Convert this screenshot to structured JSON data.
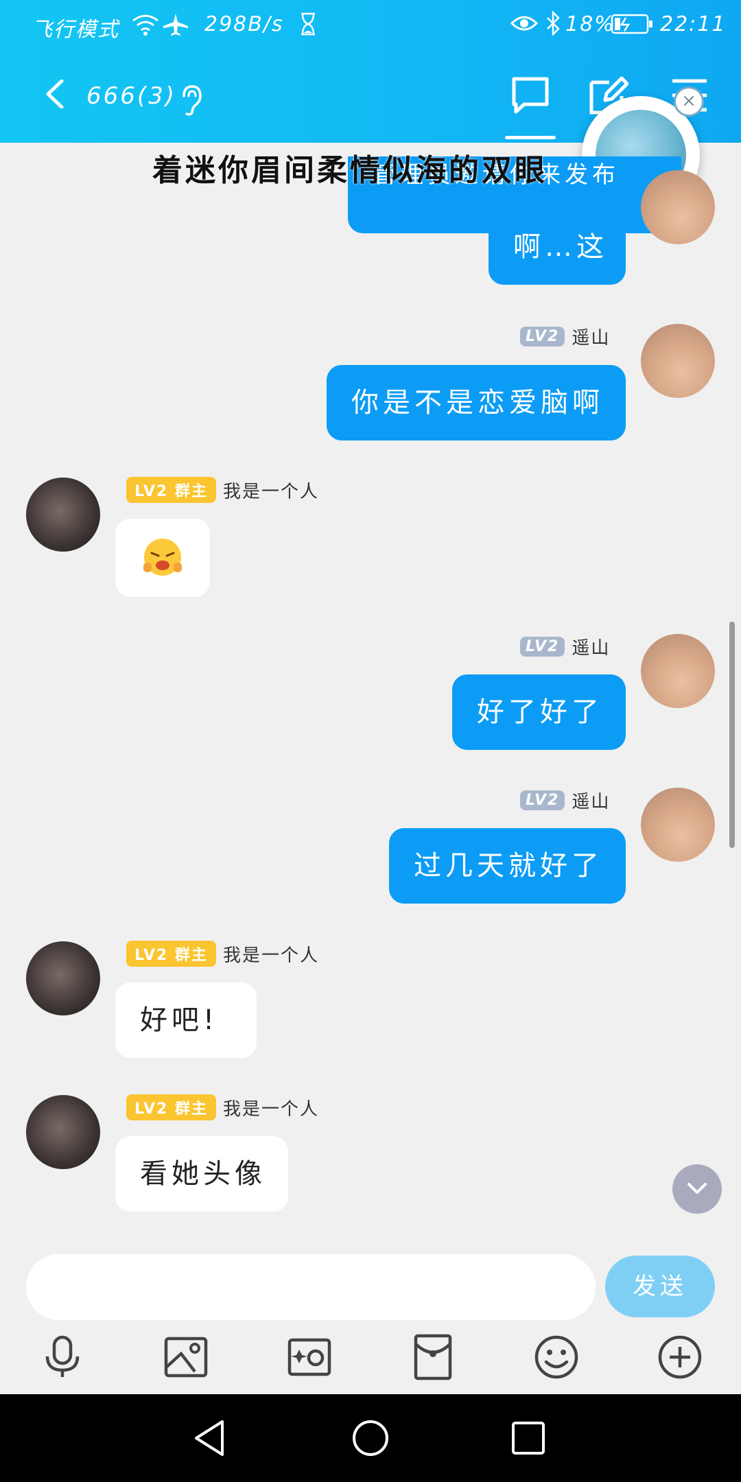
{
  "status_bar": {
    "left_text": "飞行模式",
    "speed": "298B/s",
    "battery": "18%",
    "time": "22:11"
  },
  "header": {
    "title": "666(3)"
  },
  "lyric": "着迷你眉间柔情似海的双眼",
  "messages": [
    {
      "side": "right",
      "text": "管理员邀请你来发布"
    },
    {
      "side": "right",
      "text": "啊…这"
    },
    {
      "side": "right",
      "level": "LV2",
      "name": "遥山",
      "text": "你是不是恋爱脑啊"
    },
    {
      "side": "left",
      "level": "LV2",
      "role": "群主",
      "name": "我是一个人",
      "emoji": "sad-face-emoji"
    },
    {
      "side": "right",
      "level": "LV2",
      "name": "遥山",
      "text": "好了好了"
    },
    {
      "side": "right",
      "level": "LV2",
      "name": "遥山",
      "text": "过几天就好了"
    },
    {
      "side": "left",
      "level": "LV2",
      "role": "群主",
      "name": "我是一个人",
      "text": "好吧!"
    },
    {
      "side": "left",
      "level": "LV2",
      "role": "群主",
      "name": "我是一个人",
      "text": "看她头像"
    }
  ],
  "input": {
    "send_label": "发送",
    "value": ""
  },
  "toolbar": [
    "microphone-icon",
    "image-icon",
    "camera-icon",
    "red-packet-icon",
    "emoji-icon",
    "plus-icon"
  ],
  "colors": {
    "header": "#13c6f3",
    "bubble_blue": "#0c9cf5",
    "owner_badge": "#fbc531",
    "level_badge": "#a9b7cd"
  }
}
